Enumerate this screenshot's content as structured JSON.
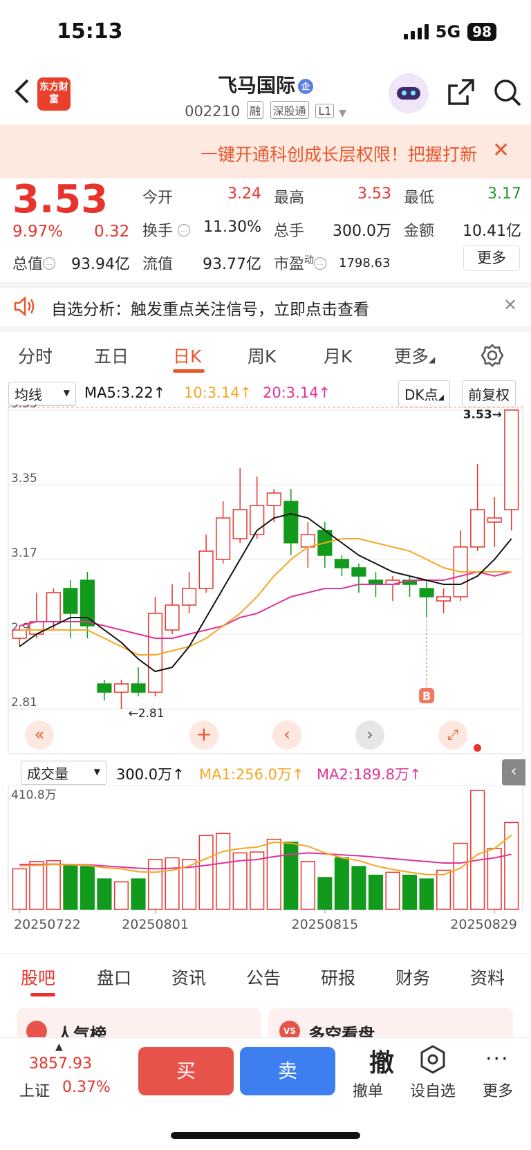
{
  "status": {
    "time": "15:13",
    "network": "5G",
    "battery": "98"
  },
  "header": {
    "logo_text": "东方财富",
    "stock_name": "飞马国际",
    "cert_badge": "企",
    "code": "002210",
    "tags": [
      "融",
      "深股通",
      "L1"
    ]
  },
  "promo": {
    "text": "一键开通科创成长层权限！把握打新"
  },
  "quote": {
    "price": "3.53",
    "change_pct": "9.97%",
    "change": "0.32",
    "labels": {
      "open": "今开",
      "high": "最高",
      "low": "最低",
      "turnover": "换手",
      "volume": "总手",
      "amount": "金额",
      "mktcap": "总值",
      "float": "流值",
      "pe": "市盈",
      "pe_sup": "动",
      "more": "更多"
    },
    "open": "3.24",
    "high": "3.53",
    "low": "3.17",
    "turnover": "11.30%",
    "volume": "300.0万",
    "amount": "10.41亿",
    "mktcap": "93.94亿",
    "float": "93.77亿",
    "pe": "1798.63"
  },
  "notice": {
    "text": "自选分析：触发重点关注信号，立即点击查看"
  },
  "tabs": [
    "分时",
    "五日",
    "日K",
    "周K",
    "月K",
    "更多"
  ],
  "active_tab": "日K",
  "indicator": {
    "ma_select": "均线",
    "ma5": "MA5:3.22↑",
    "ma10": "10:3.14↑",
    "ma20": "20:3.14↑",
    "dk_button": "DK点",
    "adjust_button": "前复权"
  },
  "vol_indicator": {
    "select": "成交量",
    "vol": "300.0万↑",
    "ma1": "MA1:256.0万↑",
    "ma2": "MA2:189.8万↑"
  },
  "colors": {
    "up": "#e7332b",
    "down": "#119a1c",
    "ma5": "#111111",
    "ma10": "#f5a623",
    "ma20": "#e0339a",
    "accent": "#e8562c"
  },
  "chart_data": {
    "type": "candlestick",
    "y_ticks": [
      "3.53",
      "3.35",
      "3.17",
      "2.99",
      "2.81"
    ],
    "ylim": [
      2.81,
      3.53
    ],
    "last_price_label": "3.53→",
    "low_marker_label": "←2.81",
    "b_marker": "B",
    "dates": [
      "20250722",
      "20250801",
      "20250815",
      "20250829"
    ],
    "candles": [
      {
        "o": 2.98,
        "c": 3.0,
        "h": 3.01,
        "l": 2.96
      },
      {
        "o": 2.99,
        "c": 3.02,
        "h": 3.09,
        "l": 2.98
      },
      {
        "o": 3.02,
        "c": 3.09,
        "h": 3.1,
        "l": 3.0
      },
      {
        "o": 3.1,
        "c": 3.04,
        "h": 3.12,
        "l": 2.98
      },
      {
        "o": 3.12,
        "c": 3.01,
        "h": 3.14,
        "l": 2.98
      },
      {
        "o": 2.87,
        "c": 2.85,
        "h": 2.88,
        "l": 2.83
      },
      {
        "o": 2.85,
        "c": 2.87,
        "h": 2.88,
        "l": 2.81
      },
      {
        "o": 2.87,
        "c": 2.85,
        "h": 2.91,
        "l": 2.84
      },
      {
        "o": 2.85,
        "c": 3.04,
        "h": 3.08,
        "l": 2.84
      },
      {
        "o": 3.0,
        "c": 3.06,
        "h": 3.11,
        "l": 2.99
      },
      {
        "o": 3.06,
        "c": 3.1,
        "h": 3.14,
        "l": 3.04
      },
      {
        "o": 3.1,
        "c": 3.19,
        "h": 3.23,
        "l": 3.09
      },
      {
        "o": 3.17,
        "c": 3.27,
        "h": 3.31,
        "l": 3.16
      },
      {
        "o": 3.22,
        "c": 3.29,
        "h": 3.39,
        "l": 3.21
      },
      {
        "o": 3.23,
        "c": 3.3,
        "h": 3.37,
        "l": 3.22
      },
      {
        "o": 3.3,
        "c": 3.33,
        "h": 3.34,
        "l": 3.26
      },
      {
        "o": 3.31,
        "c": 3.21,
        "h": 3.34,
        "l": 3.18
      },
      {
        "o": 3.2,
        "c": 3.23,
        "h": 3.26,
        "l": 3.15
      },
      {
        "o": 3.24,
        "c": 3.18,
        "h": 3.26,
        "l": 3.15
      },
      {
        "o": 3.17,
        "c": 3.15,
        "h": 3.18,
        "l": 3.13
      },
      {
        "o": 3.15,
        "c": 3.13,
        "h": 3.16,
        "l": 3.09
      },
      {
        "o": 3.12,
        "c": 3.11,
        "h": 3.14,
        "l": 3.08
      },
      {
        "o": 3.11,
        "c": 3.12,
        "h": 3.13,
        "l": 3.07
      },
      {
        "o": 3.12,
        "c": 3.11,
        "h": 3.13,
        "l": 3.08
      },
      {
        "o": 3.1,
        "c": 3.08,
        "h": 3.12,
        "l": 3.03
      },
      {
        "o": 3.07,
        "c": 3.08,
        "h": 3.1,
        "l": 3.04
      },
      {
        "o": 3.08,
        "c": 3.2,
        "h": 3.24,
        "l": 3.07
      },
      {
        "o": 3.2,
        "c": 3.29,
        "h": 3.4,
        "l": 3.19
      },
      {
        "o": 3.26,
        "c": 3.27,
        "h": 3.32,
        "l": 3.2
      },
      {
        "o": 3.29,
        "c": 3.53,
        "h": 3.53,
        "l": 3.24
      }
    ],
    "ma5": [
      2.96,
      2.99,
      3.01,
      3.03,
      3.03,
      3.0,
      2.97,
      2.93,
      2.9,
      2.91,
      2.96,
      3.03,
      3.1,
      3.17,
      3.24,
      3.27,
      3.28,
      3.27,
      3.24,
      3.21,
      3.18,
      3.16,
      3.14,
      3.13,
      3.12,
      3.11,
      3.11,
      3.13,
      3.17,
      3.22
    ],
    "ma10": [
      3.0,
      3.0,
      3.0,
      3.0,
      3.0,
      2.98,
      2.96,
      2.94,
      2.94,
      2.95,
      2.96,
      2.98,
      3.01,
      3.04,
      3.08,
      3.13,
      3.17,
      3.2,
      3.21,
      3.22,
      3.22,
      3.21,
      3.2,
      3.19,
      3.17,
      3.15,
      3.14,
      3.14,
      3.14,
      3.14
    ],
    "ma20": [
      3.01,
      3.02,
      3.02,
      3.02,
      3.02,
      3.01,
      3.0,
      2.99,
      2.98,
      2.98,
      2.99,
      3.0,
      3.01,
      3.03,
      3.04,
      3.06,
      3.08,
      3.09,
      3.1,
      3.1,
      3.11,
      3.11,
      3.11,
      3.12,
      3.12,
      3.12,
      3.13,
      3.14,
      3.13,
      3.14
    ],
    "volume_label": "410.8万",
    "volume_max": 410.8,
    "volume": [
      140,
      165,
      168,
      150,
      148,
      105,
      95,
      105,
      172,
      178,
      172,
      255,
      262,
      195,
      198,
      242,
      232,
      165,
      110,
      178,
      148,
      118,
      128,
      118,
      105,
      135,
      228,
      410.8,
      210,
      300
    ],
    "vol_ma1": [
      150,
      152,
      155,
      154,
      152,
      144,
      140,
      130,
      128,
      135,
      150,
      175,
      200,
      210,
      215,
      232,
      228,
      218,
      195,
      178,
      168,
      150,
      138,
      128,
      120,
      120,
      142,
      190,
      210,
      256
    ],
    "vol_ma2": [
      155,
      155,
      156,
      155,
      154,
      150,
      146,
      142,
      140,
      142,
      145,
      152,
      160,
      168,
      172,
      182,
      190,
      195,
      192,
      188,
      185,
      180,
      175,
      170,
      165,
      160,
      160,
      170,
      178,
      190
    ]
  },
  "bottom_tabs": [
    "股吧",
    "盘口",
    "资讯",
    "公告",
    "研报",
    "财务",
    "资料"
  ],
  "cards": [
    "人气榜",
    "多空看盘"
  ],
  "index": {
    "value": "3857.93",
    "name": "上证",
    "pct": "0.37%"
  },
  "toolbar": {
    "buy": "买",
    "sell": "卖",
    "cancel_big": "撤",
    "cancel": "撤单",
    "watch": "设自选",
    "more": "更多"
  }
}
